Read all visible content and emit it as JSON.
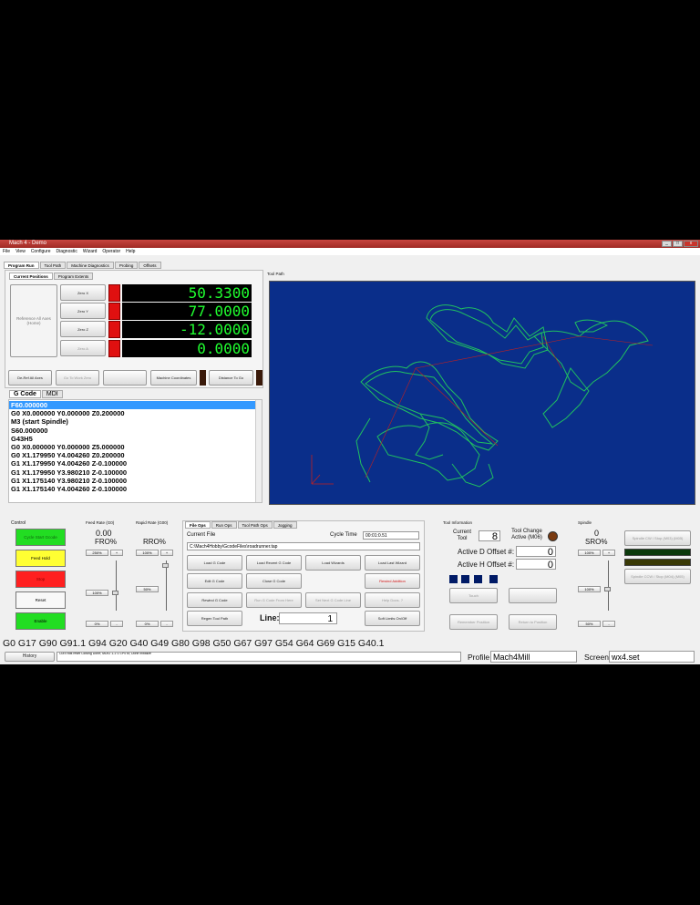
{
  "window": {
    "title": "Mach 4 - Demo",
    "min": "_",
    "max": "□",
    "close": "x"
  },
  "menu": [
    "File",
    "View",
    "Configure",
    "Diagnostic",
    "Wizard",
    "Operator",
    "Help"
  ],
  "tabs": [
    "Program Run",
    "Tool Path",
    "Machine Diagnostics",
    "Probing",
    "Offsets"
  ],
  "positions": {
    "tabs": [
      "Current Positions",
      "Program Extents"
    ],
    "reference_label": "Reference All Axes (Home)",
    "axes": [
      {
        "zero_label": "Zero X",
        "value": "50.3300"
      },
      {
        "zero_label": "Zero Y",
        "value": "77.0000"
      },
      {
        "zero_label": "Zero Z",
        "value": "-12.0000"
      },
      {
        "zero_label": "Zero A",
        "value": "0.0000"
      }
    ],
    "buttons": {
      "deref": "De-Ref All Axes",
      "goto_zero": "Go To Work Zero",
      "machine_coords": "Machine Coordinates",
      "dist_to_go": "Distance To Go"
    }
  },
  "gcode": {
    "tabs": [
      "G Code",
      "MDI"
    ],
    "lines": [
      "F60.000000",
      "G0 X0.000000 Y0.000000 Z0.200000",
      "M3 (start Spindle)",
      "S60.000000",
      "G43H5",
      "G0 X0.000000 Y0.000000 Z5.000000",
      "G0 X1.179950 Y4.004260 Z0.200000",
      "G1 X1.179950 Y4.004260 Z-0.100000",
      "G1 X1.179950 Y3.980210 Z-0.100000",
      "G1 X1.175140 Y3.980210 Z-0.100000",
      "G1 X1.175140 Y4.004260 Z-0.100000"
    ]
  },
  "toolpath": {
    "title": "Tool Path",
    "bg_color": "#0a2e8a",
    "path_color": "#20c060"
  },
  "control": {
    "title": "Control",
    "cycle_start": "Cycle Start Gcode",
    "feed_hold": "Feed Hold",
    "stop": "Stop",
    "reset": "Reset",
    "enable": "Enable"
  },
  "feed_rate": {
    "title": "Feed Rate (G0)",
    "value": "0.00",
    "label": "FRO%",
    "b1": "250%",
    "plus": "+",
    "b2": "100%",
    "b3": "0%",
    "minus": "-"
  },
  "rapid_rate": {
    "title": "Rapid Rate (G00)",
    "label": "RRO%",
    "b1": "100%",
    "plus": "+",
    "b2": "50%",
    "b3": "0%",
    "minus": "-"
  },
  "file_ops": {
    "tabs": [
      "File Ops",
      "Run Ops",
      "Tool Path Ops",
      "Jogging"
    ],
    "current_file_label": "Current File",
    "cycle_time_label": "Cycle Time",
    "cycle_time": "00:01:0.51",
    "file_path": "C:\\Mach4Hobby\\GcodeFiles\\roadrunner.tap",
    "buttons": [
      "Load G Code",
      "Load Recent G Code",
      "Load Wizards",
      "Load Last Wizard",
      "Edit G Code",
      "Close G Code",
      "",
      "Rewind Addition",
      "Rewind G Code",
      "Run G Code From Here",
      "Set Next G Code Line",
      "Help Docs. ?",
      "Regen Tool Path",
      "",
      "",
      "Soft Limits On/Off"
    ],
    "line_label": "Line:",
    "line_value": "1"
  },
  "tool_info": {
    "title": "Tool Information",
    "current_tool_label": "Current Tool",
    "current_tool": "8",
    "tool_change_label": "Tool Change Active (M06)",
    "d_offset_label": "Active D Offset #:",
    "d_offset": "0",
    "h_offset_label": "Active H Offset #:",
    "h_offset": "0",
    "touch": "Touch",
    "remember": "Remember Position",
    "return": "Return to Position"
  },
  "spindle": {
    "title": "Spindle",
    "value": "0",
    "label": "SRO%",
    "b1": "100%",
    "plus": "+",
    "b2": "100%",
    "b3": "50%",
    "minus": "-",
    "cw": "Spindle CW / Stop (M03) (M05)",
    "ccw": "Spindle CCW / Stop (M04) (M05)"
  },
  "modal_line": "G0 G17 G90 G91.1 G94 G20 G40 G49 G80 G98 G50 G67 G97 G54 G64 G69 G15 G40.1",
  "status": {
    "history": "History",
    "messages": "Cut Ends reset Closing Done; MDIO 1-1 O 1P0 to; Done Initialize",
    "profile_label": "Profile",
    "profile": "Mach4Mill",
    "screen_label": "Screen",
    "screen": "wx4.set"
  },
  "colors": {
    "dro_text": "#20ff30",
    "led_red": "#e01010",
    "cycle_start": "#22dd22",
    "feed_hold": "#ffff33",
    "stop": "#ff2020",
    "enable": "#22dd22",
    "square_led": "#001a66"
  }
}
